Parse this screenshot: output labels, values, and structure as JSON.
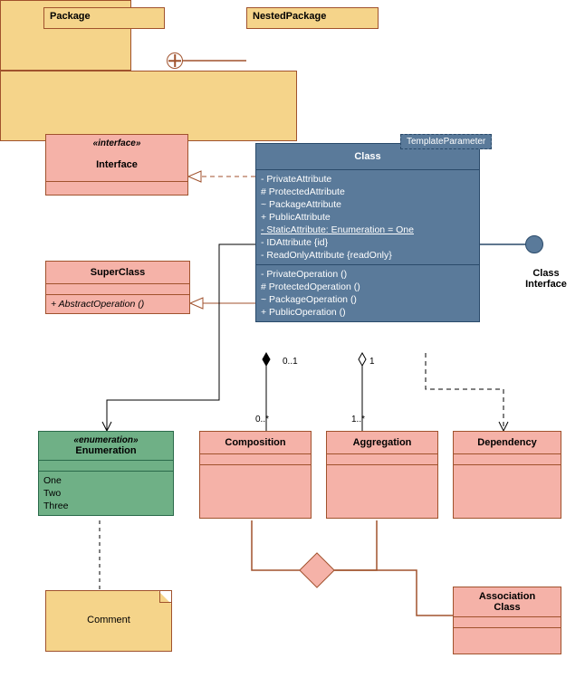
{
  "packages": {
    "package": {
      "name": "Package"
    },
    "nested": {
      "name": "NestedPackage"
    }
  },
  "classifiers": {
    "interface": {
      "stereotype": "«interface»",
      "name": "Interface"
    },
    "superclass": {
      "name": "SuperClass",
      "operations": [
        "+ AbstractOperation ()"
      ]
    },
    "main": {
      "name": "Class",
      "template_param": "TemplateParameter",
      "attributes": [
        "- PrivateAttribute",
        "# ProtectedAttribute",
        "~ PackageAttribute",
        "+ PublicAttribute",
        "- StaticAttribute: Enumeration = One",
        "- IDAttribute {id}",
        "- ReadOnlyAttribute {readOnly}"
      ],
      "operations": [
        "- PrivateOperation ()",
        "# ProtectedOperation ()",
        "~ PackageOperation ()",
        "+ PublicOperation ()"
      ]
    },
    "provided_interface": {
      "line1": "Class",
      "line2": "Interface"
    },
    "enumeration": {
      "stereotype": "«enumeration»",
      "name": "Enumeration",
      "literals": [
        "One",
        "Two",
        "Three"
      ]
    },
    "composition": {
      "name": "Composition"
    },
    "aggregation": {
      "name": "Aggregation"
    },
    "dependency": {
      "name": "Dependency"
    },
    "assoc_class": {
      "line1": "Association",
      "line2": "Class"
    }
  },
  "relations": {
    "composition": {
      "src_mult": "0..1",
      "tgt_mult": "0..*"
    },
    "aggregation": {
      "src_mult": "1",
      "tgt_mult": "1..*"
    }
  },
  "comment": {
    "text": "Comment"
  }
}
